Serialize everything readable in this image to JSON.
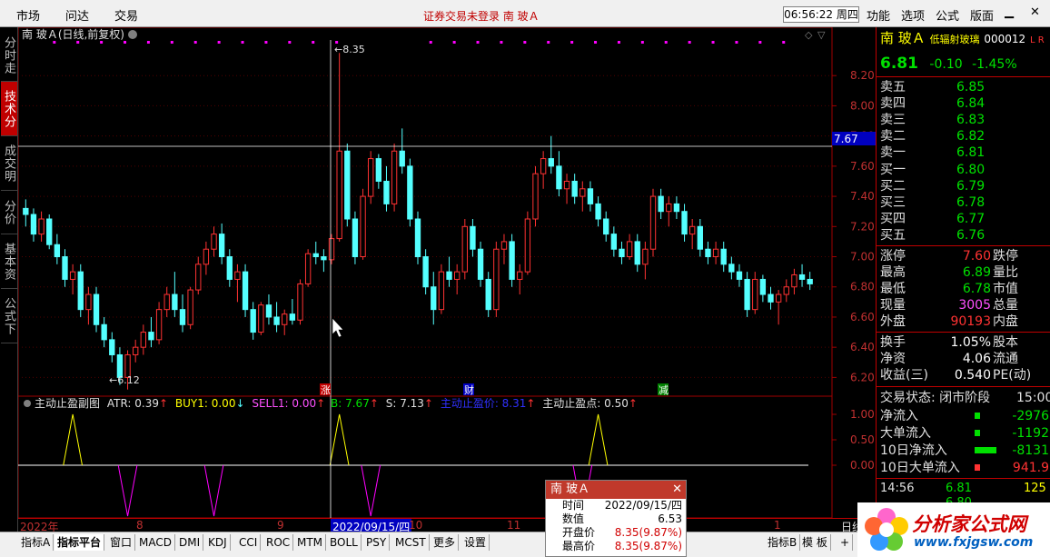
{
  "topbar": {
    "menus": [
      "市场",
      "问达",
      "交易"
    ],
    "status_text": "证券交易未登录",
    "stock_title": "南 玻Ａ",
    "clock": "06:56:22 周四",
    "right_menus": [
      "功能",
      "选项",
      "公式",
      "版面"
    ]
  },
  "left_tabs": [
    "分时走势",
    "技术分析",
    "成交明细",
    "分价表",
    "基本资料",
    "公式下载"
  ],
  "chart": {
    "title": "南 玻Ａ(日线,前复权)",
    "y_ticks": [
      "8.20",
      "8.00",
      "7.80",
      "7.60",
      "7.40",
      "7.20",
      "7.00",
      "6.80",
      "6.60",
      "6.40",
      "6.20"
    ],
    "high_label": "8.35",
    "low_label": "6.12",
    "crosshair_price": "7.67",
    "event_labels": [
      "涨",
      "财",
      "减"
    ],
    "indicator": {
      "name": "主动止盈副图",
      "atr": "ATR: 0.39",
      "buy1": "BUY1: 0.00",
      "sell1": "SELL1: 0.00",
      "b": "B: 7.67",
      "s": "S: 7.13",
      "stop_price": "主动止盈价: 8.31",
      "stop_point": "主动止盈点: 0.50",
      "y_ticks": [
        "1.00",
        "0.50",
        "0.00"
      ]
    }
  },
  "chart_data": {
    "type": "candlestick",
    "ylim": [
      6.1,
      8.4
    ],
    "candles": [
      [
        7.32,
        7.38,
        7.2,
        7.28
      ],
      [
        7.28,
        7.32,
        7.1,
        7.15
      ],
      [
        7.15,
        7.3,
        7.1,
        7.25
      ],
      [
        7.25,
        7.28,
        7.05,
        7.08
      ],
      [
        7.08,
        7.15,
        6.95,
        7.0
      ],
      [
        7.0,
        7.05,
        6.8,
        6.85
      ],
      [
        6.85,
        6.95,
        6.75,
        6.9
      ],
      [
        6.9,
        6.95,
        6.6,
        6.65
      ],
      [
        6.65,
        6.8,
        6.55,
        6.75
      ],
      [
        6.75,
        6.8,
        6.5,
        6.55
      ],
      [
        6.55,
        6.6,
        6.4,
        6.45
      ],
      [
        6.45,
        6.5,
        6.3,
        6.35
      ],
      [
        6.35,
        6.4,
        6.15,
        6.2
      ],
      [
        6.2,
        6.38,
        6.12,
        6.35
      ],
      [
        6.35,
        6.45,
        6.3,
        6.4
      ],
      [
        6.4,
        6.55,
        6.35,
        6.5
      ],
      [
        6.5,
        6.6,
        6.4,
        6.45
      ],
      [
        6.45,
        6.7,
        6.42,
        6.65
      ],
      [
        6.65,
        6.8,
        6.6,
        6.75
      ],
      [
        6.75,
        6.9,
        6.6,
        6.65
      ],
      [
        6.65,
        6.75,
        6.5,
        6.55
      ],
      [
        6.55,
        6.8,
        6.52,
        6.78
      ],
      [
        6.78,
        7.0,
        6.75,
        6.95
      ],
      [
        6.95,
        7.1,
        6.88,
        7.05
      ],
      [
        7.05,
        7.2,
        7.0,
        7.15
      ],
      [
        7.15,
        7.22,
        6.95,
        7.0
      ],
      [
        7.0,
        7.05,
        6.8,
        6.85
      ],
      [
        6.85,
        6.95,
        6.7,
        6.9
      ],
      [
        6.9,
        6.95,
        6.6,
        6.65
      ],
      [
        6.65,
        6.7,
        6.45,
        6.5
      ],
      [
        6.5,
        6.7,
        6.48,
        6.68
      ],
      [
        6.68,
        6.75,
        6.55,
        6.6
      ],
      [
        6.6,
        6.7,
        6.5,
        6.55
      ],
      [
        6.55,
        6.65,
        6.48,
        6.62
      ],
      [
        6.62,
        6.72,
        6.55,
        6.58
      ],
      [
        6.58,
        6.85,
        6.55,
        6.82
      ],
      [
        6.82,
        7.05,
        6.8,
        7.02
      ],
      [
        7.02,
        7.1,
        6.95,
        7.0
      ],
      [
        7.0,
        7.05,
        6.9,
        6.98
      ],
      [
        6.98,
        7.15,
        6.95,
        7.12
      ],
      [
        7.12,
        8.35,
        7.1,
        7.7
      ],
      [
        7.7,
        7.75,
        7.2,
        7.25
      ],
      [
        7.25,
        7.3,
        6.95,
        7.0
      ],
      [
        7.0,
        7.45,
        6.98,
        7.4
      ],
      [
        7.4,
        7.7,
        7.35,
        7.65
      ],
      [
        7.65,
        7.68,
        7.45,
        7.5
      ],
      [
        7.5,
        7.6,
        7.3,
        7.35
      ],
      [
        7.35,
        7.75,
        7.3,
        7.7
      ],
      [
        7.7,
        7.85,
        7.55,
        7.6
      ],
      [
        7.6,
        7.65,
        7.2,
        7.25
      ],
      [
        7.25,
        7.3,
        6.95,
        7.0
      ],
      [
        7.0,
        7.05,
        6.75,
        6.8
      ],
      [
        6.8,
        6.9,
        6.55,
        6.65
      ],
      [
        6.65,
        6.95,
        6.62,
        6.9
      ],
      [
        6.9,
        7.0,
        6.8,
        6.85
      ],
      [
        6.85,
        6.95,
        6.75,
        6.9
      ],
      [
        6.9,
        7.25,
        6.85,
        7.2
      ],
      [
        7.2,
        7.25,
        7.0,
        7.05
      ],
      [
        7.05,
        7.1,
        6.8,
        6.85
      ],
      [
        6.85,
        6.9,
        6.6,
        6.65
      ],
      [
        6.65,
        7.1,
        6.6,
        7.05
      ],
      [
        7.05,
        7.15,
        6.95,
        7.1
      ],
      [
        7.1,
        7.15,
        6.8,
        6.85
      ],
      [
        6.85,
        6.95,
        6.75,
        6.9
      ],
      [
        6.9,
        7.3,
        6.88,
        7.25
      ],
      [
        7.25,
        7.6,
        7.2,
        7.55
      ],
      [
        7.55,
        7.7,
        7.45,
        7.65
      ],
      [
        7.65,
        7.8,
        7.55,
        7.6
      ],
      [
        7.6,
        7.7,
        7.4,
        7.45
      ],
      [
        7.45,
        7.55,
        7.35,
        7.5
      ],
      [
        7.5,
        7.55,
        7.35,
        7.4
      ],
      [
        7.4,
        7.5,
        7.3,
        7.45
      ],
      [
        7.45,
        7.5,
        7.3,
        7.35
      ],
      [
        7.35,
        7.4,
        7.2,
        7.25
      ],
      [
        7.25,
        7.3,
        7.1,
        7.15
      ],
      [
        7.15,
        7.2,
        7.0,
        7.05
      ],
      [
        7.05,
        7.1,
        6.95,
        7.0
      ],
      [
        7.0,
        7.15,
        6.98,
        7.1
      ],
      [
        7.1,
        7.15,
        6.9,
        6.95
      ],
      [
        6.95,
        7.1,
        6.85,
        7.05
      ],
      [
        7.05,
        7.45,
        7.0,
        7.4
      ],
      [
        7.4,
        7.45,
        7.25,
        7.3
      ],
      [
        7.3,
        7.4,
        7.2,
        7.35
      ],
      [
        7.35,
        7.4,
        7.25,
        7.3
      ],
      [
        7.3,
        7.35,
        7.1,
        7.15
      ],
      [
        7.15,
        7.25,
        7.05,
        7.2
      ],
      [
        7.2,
        7.25,
        7.0,
        7.05
      ],
      [
        7.05,
        7.1,
        6.95,
        7.0
      ],
      [
        7.0,
        7.1,
        6.95,
        7.05
      ],
      [
        7.05,
        7.1,
        6.9,
        6.95
      ],
      [
        6.95,
        7.0,
        6.85,
        6.9
      ],
      [
        6.9,
        6.95,
        6.8,
        6.85
      ],
      [
        6.85,
        6.9,
        6.6,
        6.65
      ],
      [
        6.65,
        6.9,
        6.62,
        6.85
      ],
      [
        6.85,
        6.88,
        6.7,
        6.75
      ],
      [
        6.75,
        6.8,
        6.65,
        6.7
      ],
      [
        6.7,
        6.78,
        6.55,
        6.75
      ],
      [
        6.75,
        6.85,
        6.7,
        6.8
      ],
      [
        6.8,
        6.92,
        6.75,
        6.88
      ],
      [
        6.88,
        6.95,
        6.8,
        6.85
      ],
      [
        6.85,
        6.9,
        6.78,
        6.82
      ]
    ],
    "indicator_signals": [
      [
        6,
        1
      ],
      [
        13,
        -1
      ],
      [
        24,
        -1
      ],
      [
        40,
        1
      ],
      [
        44,
        -1
      ],
      [
        71,
        -1
      ],
      [
        73,
        1
      ]
    ]
  },
  "dates": [
    "2022年",
    "8",
    "9",
    "2022/09/15/四",
    "10",
    "11",
    "12",
    "1",
    "日线"
  ],
  "quote": {
    "name": "南 玻Ａ",
    "tag": "低辐射玻璃",
    "code": "000012",
    "lr": "L R",
    "price": "6.81",
    "change": "-0.10",
    "pct": "-1.45%",
    "asks": [
      [
        "卖五",
        "6.85"
      ],
      [
        "卖四",
        "6.84"
      ],
      [
        "卖三",
        "6.83"
      ],
      [
        "卖二",
        "6.82"
      ],
      [
        "卖一",
        "6.81"
      ]
    ],
    "bids": [
      [
        "买一",
        "6.80"
      ],
      [
        "买二",
        "6.79"
      ],
      [
        "买三",
        "6.78"
      ],
      [
        "买四",
        "6.77"
      ],
      [
        "买五",
        "6.76"
      ]
    ],
    "stats": [
      [
        "涨停",
        "7.60",
        "跌停"
      ],
      [
        "最高",
        "6.89",
        "量比"
      ],
      [
        "最低",
        "6.78",
        "市值"
      ],
      [
        "现量",
        "3005",
        "总量"
      ],
      [
        "外盘",
        "90193",
        "内盘"
      ]
    ],
    "fund": [
      [
        "换手",
        "1.05%",
        "股本"
      ],
      [
        "净资",
        "4.06",
        "流通"
      ],
      [
        "收益(三)",
        "0.540",
        "PE(动)"
      ]
    ],
    "trade_status": "交易状态: 闭市阶段",
    "trade_time": "15:00",
    "flows": [
      [
        "净流入",
        "-2976"
      ],
      [
        "大单流入",
        "-1192"
      ],
      [
        "10日净流入",
        "-8131"
      ],
      [
        "10日大单流入",
        "941.9"
      ]
    ],
    "tick": [
      "14:56",
      "6.81",
      "125"
    ],
    "tick2": "6.80"
  },
  "popup": {
    "title": "南 玻Ａ",
    "close": "✕",
    "rows": [
      [
        "时间",
        "2022/09/15/四"
      ],
      [
        "数值",
        "6.53"
      ],
      [
        "开盘价",
        "8.35(9.87%)"
      ],
      [
        "最高价",
        "8.35(9.87%)"
      ]
    ]
  },
  "tabs": [
    "指标A",
    "指标平台",
    "窗口",
    "MACD",
    "DMI",
    "KDJ",
    "CCI",
    "ROC",
    "MTM",
    "BOLL",
    "PSY",
    "MCST",
    "更多",
    "设置"
  ],
  "tabs_right": [
    "指标B",
    "模 板",
    "+"
  ],
  "logo": {
    "t1": "分析家公式网",
    "t2": "www.fxjgsw.com"
  },
  "colors": {
    "up": "#ff3232",
    "down": "#54ffff",
    "bg": "#000000",
    "accent": "#c00000"
  }
}
